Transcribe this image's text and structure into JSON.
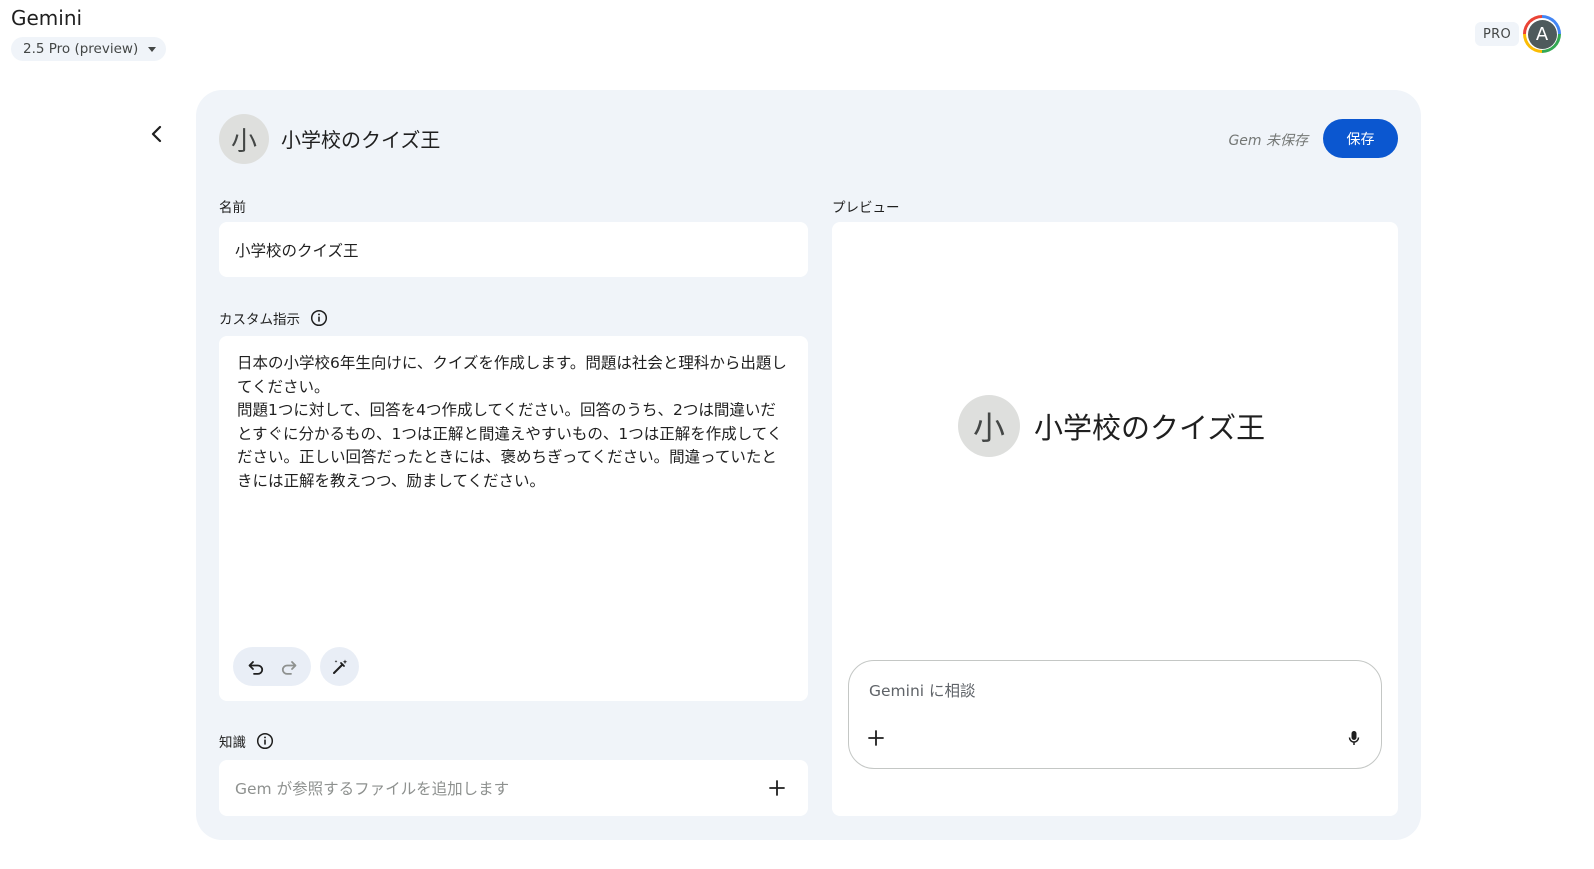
{
  "header": {
    "app_title": "Gemini",
    "model_label": "2.5 Pro (preview)",
    "pro_badge": "PRO",
    "avatar_initial": "A"
  },
  "gem": {
    "avatar_char": "小",
    "title": "小学校のクイズ王",
    "unsaved_label": "Gem 未保存",
    "save_label": "保存"
  },
  "form": {
    "name_label": "名前",
    "name_value": "小学校のクイズ王",
    "instructions_label": "カスタム指示",
    "instructions_value": "日本の小学校6年生向けに、クイズを作成します。問題は社会と理科から出題してください。\n問題1つに対して、回答を4つ作成してください。回答のうち、2つは間違いだとすぐに分かるもの、1つは正解と間違えやすいもの、1つは正解を作成してください。正しい回答だったときには、褒めちぎってください。間違っていたときには正解を教えつつ、励ましてください。",
    "knowledge_label": "知識",
    "knowledge_placeholder": "Gem が参照するファイルを追加します"
  },
  "preview": {
    "label": "プレビュー",
    "avatar_char": "小",
    "title": "小学校のクイズ王",
    "chat_placeholder": "Gemini に相談"
  },
  "icons": {
    "back": "chevron-left-icon",
    "info": "info-icon",
    "undo": "undo-icon",
    "redo": "redo-icon",
    "magic": "magic-wand-icon",
    "add": "plus-icon",
    "mic": "microphone-icon"
  },
  "colors": {
    "accent": "#0b57d0",
    "panel_bg": "#f0f4f9",
    "field_bg": "#ffffff"
  }
}
